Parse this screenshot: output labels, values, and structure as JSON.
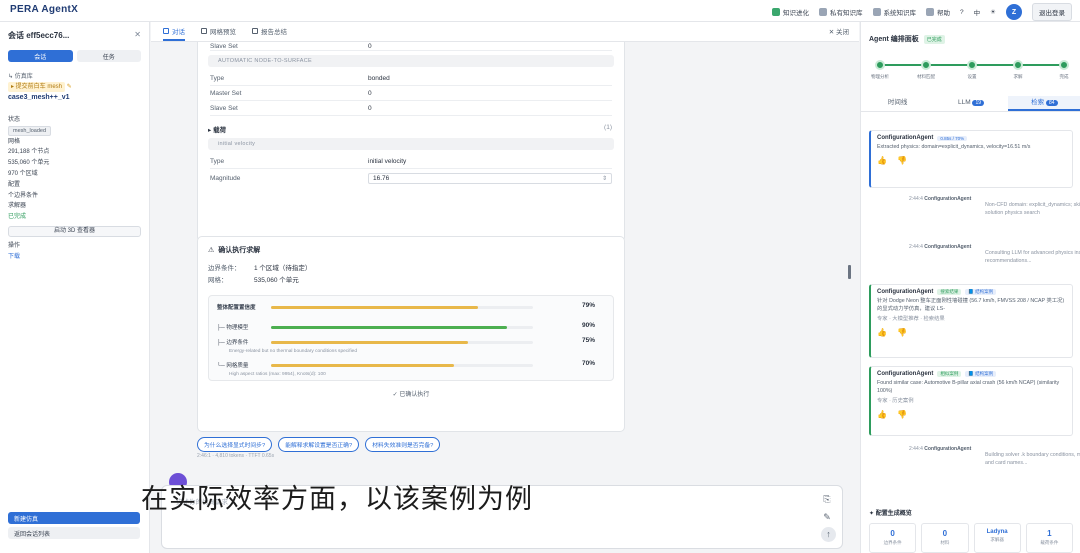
{
  "app": {
    "title": "PERA AgentX"
  },
  "topnav": [
    {
      "label": "知识进化",
      "icon": "book-icon",
      "green": true
    },
    {
      "label": "私有知识库",
      "icon": "database-icon",
      "green": false
    },
    {
      "label": "系统知识库",
      "icon": "library-icon",
      "green": false
    },
    {
      "label": "帮助",
      "icon": "help-icon",
      "green": false
    },
    {
      "label": "?",
      "icon": "question-icon",
      "green": false
    },
    {
      "label": "中",
      "icon": "language-icon",
      "green": false
    },
    {
      "label": "☀",
      "icon": "theme-icon",
      "green": false
    }
  ],
  "user": {
    "avatar": "Z",
    "logout": "退出登录"
  },
  "sidebar": {
    "session_title": "会话 eff5ecc76...",
    "close": "✕",
    "tab_active": "会话",
    "tab_other": "任务",
    "tree_root": "↳ 仿真库",
    "tree_highlight": "▸ 提交前白车 mesh",
    "case_name": "case3_mesh++_v1",
    "section_label": "状态",
    "tag": "mesh_loaded",
    "mesh_label": "网格",
    "nodes": "291,188 个节点",
    "elements": "535,060 个单元",
    "regions": "970 个区域",
    "config_label": "配置",
    "boundary": "个边界条件",
    "solver": "求解器",
    "status": "已完成",
    "view_btn": "启动 3D 查看器",
    "ops_label": "操作",
    "download": "下载",
    "new_sim": "新建仿真",
    "session_list": "返回会话列表"
  },
  "tabs": [
    {
      "label": "对话",
      "active": true
    },
    {
      "label": "网格预览",
      "active": false
    },
    {
      "label": "报告总结",
      "active": false
    }
  ],
  "close_tab": "✕ 关闭",
  "params": {
    "partial_row": {
      "k": "Slave Set",
      "v": "0"
    },
    "section1": "AUTOMATIC NODE-TO-SURFACE",
    "rows1": [
      {
        "k": "Type",
        "v": "bonded"
      },
      {
        "k": "Master Set",
        "v": "0"
      },
      {
        "k": "Slave Set",
        "v": "0"
      }
    ],
    "group_title": "▸ 载荷",
    "group_count": "(1)",
    "section2": "initial velocity",
    "rows2": [
      {
        "k": "Type",
        "v": "initial velocity"
      },
      {
        "k": "Magnitude",
        "v": "16.76"
      }
    ]
  },
  "confirm": {
    "title": "确认执行求解",
    "boundary_k": "边界条件：",
    "boundary_v": "1 个区域（待指定）",
    "mesh_k": "网格：",
    "mesh_v": "535,060 个单元",
    "overall_label": "整体配置置信度",
    "overall_pct": "79%",
    "overall": 0.79,
    "items": [
      {
        "label": "├─ 物理模型",
        "pct": "90%",
        "value": 0.9,
        "note": ""
      },
      {
        "label": "├─ 边界条件",
        "pct": "75%",
        "value": 0.75,
        "note": "Energy-related but no thermal boundary conditions specified"
      },
      {
        "label": "└─ 网格质量",
        "pct": "70%",
        "value": 0.7,
        "note": "High aspect ratios (max: 9954), Knots(d): 100"
      }
    ],
    "confirmed": "✓ 已确认执行"
  },
  "suggestions": [
    "为什么选择显式时间步?",
    "能解释求解设置是否正确?",
    "材料失效准则是否完备?"
  ],
  "meta": "2:46:1  ·  4,810 tokens  ·  TTFT 0.65s",
  "composer": {
    "placeholder": "描述你的仿真需求"
  },
  "video_subtitle": "在实际效率方面，以该案例为例",
  "right": {
    "title": "Agent 编排面板",
    "badge": "已完成",
    "steps": [
      "物理分析",
      "材料匹配",
      "设置",
      "求解",
      "完成"
    ],
    "tabs": [
      {
        "label": "时间线",
        "count": ""
      },
      {
        "label": "LLM",
        "count": "19"
      },
      {
        "label": "检索",
        "count": "84"
      }
    ],
    "events": [
      {
        "agent": "ConfigurationAgent",
        "tag": "0.85s / 70%",
        "text": "Extracted physics: domain=explicit_dynamics, velocity=16.51 m/s"
      },
      {
        "agent": "ConfigurationAgent",
        "time": "2:44:4",
        "text": "Non-CFD domain: explicit_dynamics; skipping fluid solution physics search"
      },
      {
        "agent": "ConfigurationAgent",
        "time": "2:44:4",
        "text": "Consulting LLM for advanced physics insights and recommendations..."
      },
      {
        "agent": "ConfigurationAgent",
        "tag": "搜索结果",
        "tag2": "📘 结构案例",
        "text": "针对 Dodge Neon 整车正面刚性墙碰撞 (56.7 km/h, FMVSS 208 / NCAP 类工况) 的显式动力学仿真，建议 LS-",
        "chips": "专家 · 大模型推荐 · 检索结果"
      },
      {
        "agent": "ConfigurationAgent",
        "tag": "相似案例",
        "tag2": "📘 结构案例",
        "text": "Found similar case: Automotive B-pillar axial crash (56 km/h NCAP) (similarity 100%)",
        "chips": "专家 · 历史案例"
      },
      {
        "agent": "ConfigurationAgent",
        "time": "2:44:4",
        "text": "Building solver .k boundary conditions, material, and card names..."
      }
    ],
    "summary_title": "✦ 配置生成概览",
    "stats": [
      {
        "num": "0",
        "label": "边界条件"
      },
      {
        "num": "0",
        "label": "材料"
      },
      {
        "num": "Ladyna",
        "label": "求解器"
      },
      {
        "num": "1",
        "label": "载荷条件"
      }
    ]
  }
}
